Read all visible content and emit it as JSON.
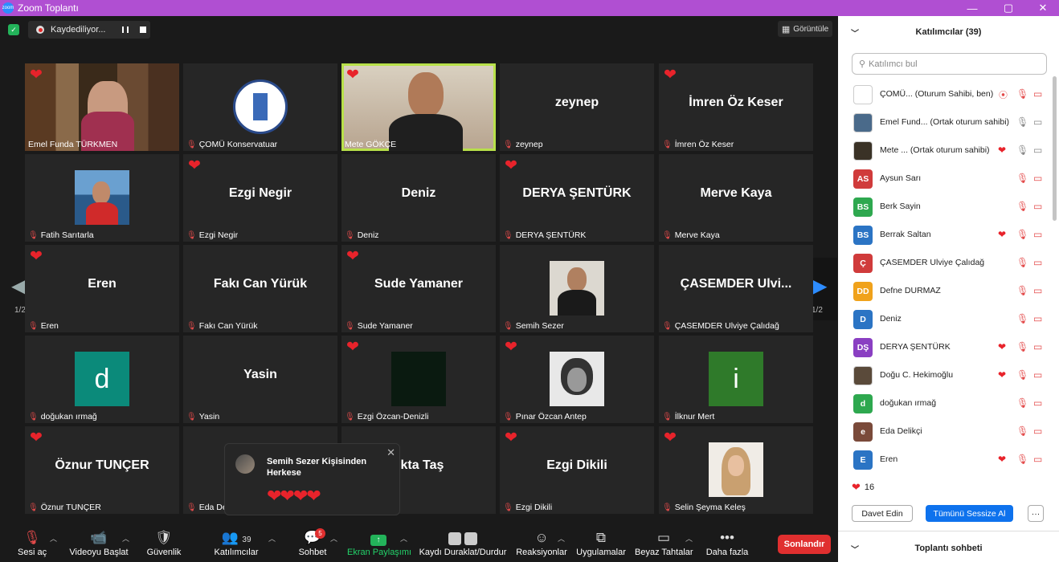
{
  "window": {
    "title": "Zoom Toplantı",
    "controls": [
      "—",
      "▢",
      "✕"
    ]
  },
  "recording": {
    "label": "Kaydediliyor..."
  },
  "view_label": "Görüntüle",
  "paging": {
    "left": "1/2",
    "right": "1/2"
  },
  "tiles": [
    {
      "name": "Emel Funda TÜRKMEN",
      "big": "",
      "kind": "video-room",
      "heart": true,
      "muted": false,
      "active": false
    },
    {
      "name": "ÇOMÜ Konservatuar",
      "big": "",
      "kind": "logo",
      "heart": false,
      "muted": true,
      "active": false
    },
    {
      "name": "Mete GÖKÇE",
      "big": "",
      "kind": "video-man",
      "heart": true,
      "muted": false,
      "active": true
    },
    {
      "name": "zeynep",
      "big": "zeynep",
      "kind": "text",
      "heart": false,
      "muted": true,
      "active": false
    },
    {
      "name": "İmren Öz Keser",
      "big": "İmren Öz Keser",
      "kind": "text",
      "heart": true,
      "muted": true,
      "active": false
    },
    {
      "name": "Fatih Sarıtarla",
      "big": "",
      "kind": "photo-sea",
      "heart": false,
      "muted": true,
      "active": false
    },
    {
      "name": "Ezgi Negir",
      "big": "Ezgi Negir",
      "kind": "text",
      "heart": true,
      "muted": true,
      "active": false
    },
    {
      "name": "Deniz",
      "big": "Deniz",
      "kind": "text",
      "heart": false,
      "muted": true,
      "active": false
    },
    {
      "name": "DERYA ŞENTÜRK",
      "big": "DERYA ŞENTÜRK",
      "kind": "text",
      "heart": true,
      "muted": true,
      "active": false
    },
    {
      "name": "Merve Kaya",
      "big": "Merve Kaya",
      "kind": "text",
      "heart": false,
      "muted": true,
      "active": false
    },
    {
      "name": "Eren",
      "big": "Eren",
      "kind": "text",
      "heart": true,
      "muted": true,
      "active": false
    },
    {
      "name": "Fakı Can Yürük",
      "big": "Fakı Can Yürük",
      "kind": "text",
      "heart": false,
      "muted": true,
      "active": false
    },
    {
      "name": "Sude Yamaner",
      "big": "Sude Yamaner",
      "kind": "text",
      "heart": true,
      "muted": true,
      "active": false
    },
    {
      "name": "Semih Sezer",
      "big": "",
      "kind": "photo-man",
      "heart": false,
      "muted": true,
      "active": false
    },
    {
      "name": "ÇASEMDER Ulviye Çalıdağ",
      "big": "ÇASEMDER  Ulvi...",
      "kind": "text",
      "heart": false,
      "muted": true,
      "active": false
    },
    {
      "name": "doğukan ırmağ",
      "big": "d",
      "kind": "letter-teal",
      "heart": false,
      "muted": true,
      "active": false
    },
    {
      "name": "Yasin",
      "big": "Yasin",
      "kind": "text",
      "heart": false,
      "muted": true,
      "active": false
    },
    {
      "name": "Ezgi Özcan-Denizli",
      "big": "",
      "kind": "photo-dark",
      "heart": true,
      "muted": true,
      "active": false
    },
    {
      "name": "Pınar Özcan Antep",
      "big": "",
      "kind": "photo-bw",
      "heart": true,
      "muted": true,
      "active": false
    },
    {
      "name": "İlknur Mert",
      "big": "i",
      "kind": "letter-green",
      "heart": false,
      "muted": true,
      "active": false
    },
    {
      "name": "Öznur TUNÇER",
      "big": "Öznur TUNÇER",
      "kind": "text",
      "heart": true,
      "muted": true,
      "active": false
    },
    {
      "name": "Eda De",
      "big": "",
      "kind": "text",
      "heart": false,
      "muted": true,
      "active": false
    },
    {
      "name": "",
      "big": "ekta Taş",
      "kind": "text",
      "heart": false,
      "muted": false,
      "active": false
    },
    {
      "name": "Ezgi Dikili",
      "big": "Ezgi Dikili",
      "kind": "text",
      "heart": true,
      "muted": true,
      "active": false
    },
    {
      "name": "Selin Şeyma Keleş",
      "big": "",
      "kind": "photo-woman",
      "heart": true,
      "muted": true,
      "active": false
    }
  ],
  "reaction_popup": {
    "title": "Semih Sezer Kişisinden Herkese",
    "hearts": "❤❤❤❤"
  },
  "toolbar": {
    "audio": "Sesi aç",
    "video": "Videoyu Başlat",
    "security": "Güvenlik",
    "participants": "Katılımcılar",
    "participants_count": "39",
    "chat": "Sohbet",
    "chat_badge": "5",
    "share": "Ekran Paylaşımı",
    "record": "Kaydı Duraklat/Durdur",
    "reactions": "Reaksiyonlar",
    "apps": "Uygulamalar",
    "whiteboard": "Beyaz Tahtalar",
    "more": "Daha fazla",
    "end": "Sonlandır"
  },
  "panel": {
    "header": "Katılımcılar (39)",
    "search_placeholder": "Katılımcı bul",
    "participants": [
      {
        "initials": "",
        "name": "ÇOMÜ...  (Oturum Sahibi, ben)",
        "color": "#ffffff",
        "heart": false,
        "rec": true,
        "micOn": false,
        "camOn": false
      },
      {
        "initials": "",
        "name": "Emel Fund...  (Ortak oturum sahibi)",
        "color": "#4a6a8a",
        "heart": false,
        "rec": false,
        "micOn": true,
        "camOn": true
      },
      {
        "initials": "",
        "name": "Mete ...  (Ortak oturum sahibi)",
        "color": "#3a3226",
        "heart": true,
        "rec": false,
        "micOn": true,
        "camOn": true
      },
      {
        "initials": "AS",
        "name": "Aysun Sarı",
        "color": "#d03b3b",
        "heart": false,
        "rec": false,
        "micOn": false,
        "camOn": false
      },
      {
        "initials": "BS",
        "name": "Berk Sayin",
        "color": "#2ea84f",
        "heart": false,
        "rec": false,
        "micOn": false,
        "camOn": false
      },
      {
        "initials": "BS",
        "name": "Berrak Saltan",
        "color": "#2b74c4",
        "heart": true,
        "rec": false,
        "micOn": false,
        "camOn": false
      },
      {
        "initials": "Ç",
        "name": "ÇASEMDER Ulviye Çalıdağ",
        "color": "#d03b3b",
        "heart": false,
        "rec": false,
        "micOn": false,
        "camOn": false
      },
      {
        "initials": "DD",
        "name": "Defne DURMAZ",
        "color": "#f0a21b",
        "heart": false,
        "rec": false,
        "micOn": false,
        "camOn": false
      },
      {
        "initials": "D",
        "name": "Deniz",
        "color": "#2b74c4",
        "heart": false,
        "rec": false,
        "micOn": false,
        "camOn": false
      },
      {
        "initials": "DŞ",
        "name": "DERYA ŞENTÜRK",
        "color": "#8a3fc2",
        "heart": true,
        "rec": false,
        "micOn": false,
        "camOn": false
      },
      {
        "initials": "",
        "name": "Doğu C. Hekimoğlu",
        "color": "#5a4a3a",
        "heart": true,
        "rec": false,
        "micOn": false,
        "camOn": false
      },
      {
        "initials": "d",
        "name": "doğukan ırmağ",
        "color": "#2ea84f",
        "heart": false,
        "rec": false,
        "micOn": false,
        "camOn": false
      },
      {
        "initials": "e",
        "name": "Eda Delikçi",
        "color": "#7a4a3a",
        "heart": false,
        "rec": false,
        "micOn": false,
        "camOn": false
      },
      {
        "initials": "E",
        "name": "Eren",
        "color": "#2b74c4",
        "heart": true,
        "rec": false,
        "micOn": false,
        "camOn": false
      }
    ],
    "reaction_count": "16",
    "invite": "Davet Edin",
    "mute_all": "Tümünü Sessize Al",
    "more": "···",
    "chat_header": "Toplantı sohbeti"
  }
}
